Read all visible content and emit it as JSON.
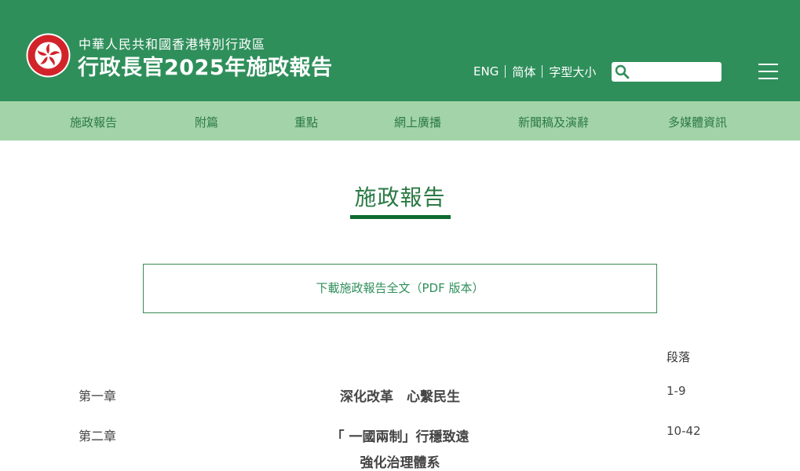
{
  "header": {
    "subtitle": "中華人民共和國香港特別行政區",
    "title": "行政長官2025年施政報告",
    "lang_eng": "ENG",
    "lang_simplified": "简体",
    "font_size": "字型大小",
    "search_placeholder": "",
    "bg_color": "#2f8f5b"
  },
  "nav": {
    "items": [
      {
        "label": "施政報告"
      },
      {
        "label": "附篇"
      },
      {
        "label": "重點"
      },
      {
        "label": "網上廣播"
      },
      {
        "label": "新聞稿及演辭"
      },
      {
        "label": "多媒體資訊"
      }
    ],
    "bg_color": "#a3d3a9"
  },
  "main": {
    "title": "施政報告",
    "download_label": "下載施政報告全文（PDF 版本）",
    "toc_header": "段落",
    "chapters": [
      {
        "chapter": "第一章",
        "title_lines": [
          "深化改革　心繫民生"
        ],
        "paragraphs": "1-9"
      },
      {
        "chapter": "第二章",
        "title_lines": [
          "「 一國兩制」行穩致遠",
          "強化治理體系"
        ],
        "paragraphs": "10-42"
      }
    ]
  }
}
